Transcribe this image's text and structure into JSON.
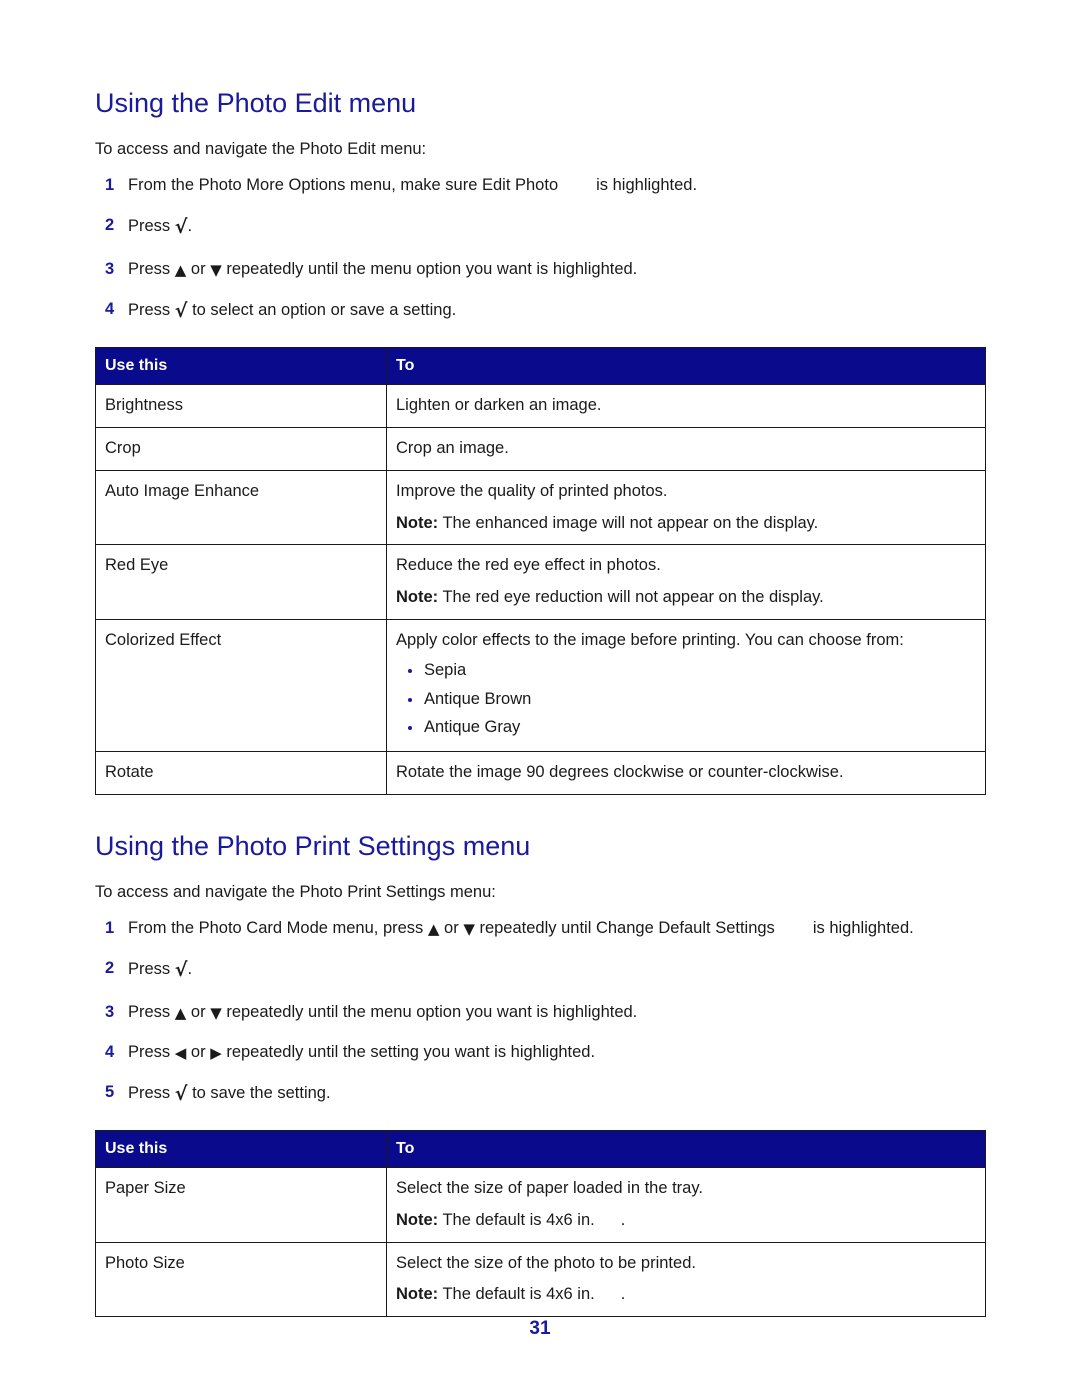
{
  "page": {
    "number": "31"
  },
  "sections": [
    {
      "heading": "Using the Photo Edit menu",
      "intro": "To access and navigate the Photo Edit menu:",
      "steps": [
        {
          "num": "1",
          "pre": "From the Photo More Options menu, make sure Edit Photo",
          "glyph": "",
          "post": "is highlighted."
        },
        {
          "num": "2",
          "pre": "Press",
          "glyph": "√",
          "post": "."
        },
        {
          "num": "3",
          "pre": "Press",
          "glyph": "▲",
          "mid": "or",
          "glyph2": "▼",
          "post": "repeatedly until the menu option you want is highlighted."
        },
        {
          "num": "4",
          "pre": "Press",
          "glyph": "√",
          "post": "to select an option or save a setting."
        }
      ],
      "table": {
        "headers": [
          "Use this",
          "To"
        ],
        "rows": [
          {
            "use": "Brightness",
            "to": "Lighten or darken an image."
          },
          {
            "use": "Crop",
            "to": "Crop an image."
          },
          {
            "use": "Auto Image Enhance",
            "to": "Improve the quality of printed photos.",
            "note_label": "Note:",
            "note_text": "The enhanced image will not appear on the display."
          },
          {
            "use": "Red Eye",
            "to": "Reduce the red eye effect in photos.",
            "note_label": "Note:",
            "note_text": "The red eye reduction will not appear on the display."
          },
          {
            "use": "Colorized Effect",
            "to": "Apply color effects to the image before printing. You can choose from:",
            "options": [
              "Sepia",
              "Antique Brown",
              "Antique Gray"
            ]
          },
          {
            "use": "Rotate",
            "to": "Rotate the image 90 degrees clockwise or counter-clockwise."
          }
        ]
      }
    },
    {
      "heading": "Using the Photo Print Settings menu",
      "intro": "To access and navigate the Photo Print Settings menu:",
      "steps": [
        {
          "num": "1",
          "pre": "From the Photo Card Mode menu, press",
          "glyph": "▲",
          "mid": "or",
          "glyph2": "▼",
          "post": "repeatedly until Change Default Settings",
          "tail": "is",
          "cont": "highlighted."
        },
        {
          "num": "2",
          "pre": "Press",
          "glyph": "√",
          "post": "."
        },
        {
          "num": "3",
          "pre": "Press",
          "glyph": "▲",
          "mid": "or",
          "glyph2": "▼",
          "post": "repeatedly until the menu option you want is highlighted."
        },
        {
          "num": "4",
          "pre": "Press",
          "glyph": "◀",
          "mid": "or",
          "glyph2": "▶",
          "post": "repeatedly until the setting you want is highlighted."
        },
        {
          "num": "5",
          "pre": "Press",
          "glyph": "√",
          "post": "to save the setting."
        }
      ],
      "table": {
        "headers": [
          "Use this",
          "To"
        ],
        "rows": [
          {
            "use": "Paper Size",
            "to": "Select the size of paper loaded in the tray.",
            "note_label": "Note:",
            "note_text": "The default is 4x6 in.",
            "note_tail": "."
          },
          {
            "use": "Photo Size",
            "to": "Select the size of the photo to be printed.",
            "note_label": "Note:",
            "note_text": "The default is 4x6 in.",
            "note_tail": "."
          }
        ]
      }
    }
  ]
}
